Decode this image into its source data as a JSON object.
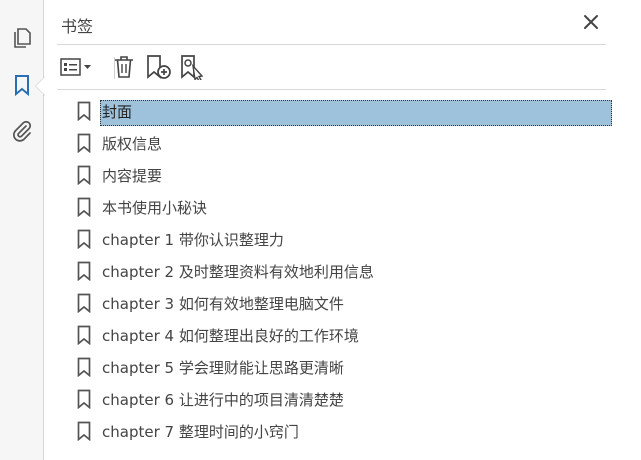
{
  "panel": {
    "title": "书签"
  },
  "rail": {
    "items": [
      {
        "name": "pages-icon"
      },
      {
        "name": "bookmark-icon"
      },
      {
        "name": "attachment-icon"
      }
    ]
  },
  "toolbar": {
    "items": [
      "options-menu-icon",
      "delete-icon",
      "new-bookmark-icon",
      "find-bookmark-icon"
    ]
  },
  "bookmarks": [
    {
      "label": "封面",
      "selected": true
    },
    {
      "label": "版权信息"
    },
    {
      "label": "内容提要"
    },
    {
      "label": "本书使用小秘诀"
    },
    {
      "label": "chapter 1 带你认识整理力"
    },
    {
      "label": "chapter 2 及时整理资料有效地利用信息"
    },
    {
      "label": "chapter 3 如何有效地整理电脑文件"
    },
    {
      "label": "chapter 4 如何整理出良好的工作环境"
    },
    {
      "label": "chapter 5 学会理财能让思路更清晰"
    },
    {
      "label": "chapter 6 让进行中的项目清清楚楚"
    },
    {
      "label": "chapter 7 整理时间的小窍门"
    }
  ],
  "colors": {
    "accent": "#2a6fb4",
    "selection": "#9ec2dc"
  }
}
